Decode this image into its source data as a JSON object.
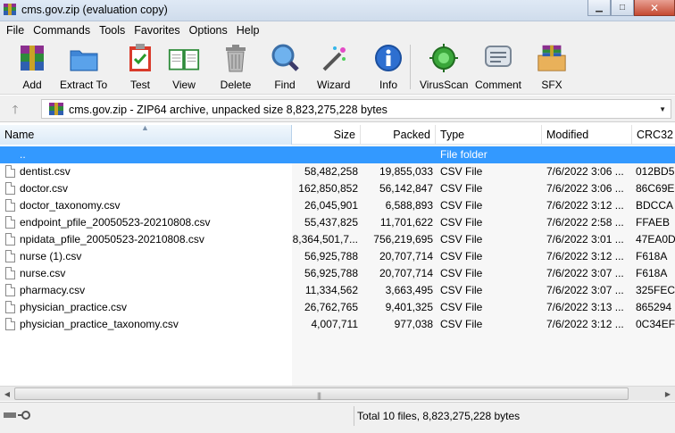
{
  "window": {
    "title": "cms.gov.zip (evaluation copy)"
  },
  "menu": [
    "File",
    "Commands",
    "Tools",
    "Favorites",
    "Options",
    "Help"
  ],
  "toolbar": {
    "add": "Add",
    "extract": "Extract To",
    "test": "Test",
    "view": "View",
    "delete": "Delete",
    "find": "Find",
    "wizard": "Wizard",
    "info": "Info",
    "virusscan": "VirusScan",
    "comment": "Comment",
    "sfx": "SFX"
  },
  "address": {
    "text": "cms.gov.zip - ZIP64 archive, unpacked size 8,823,275,228 bytes"
  },
  "columns": {
    "name": "Name",
    "size": "Size",
    "packed": "Packed",
    "type": "Type",
    "modified": "Modified",
    "crc": "CRC32"
  },
  "parent_row": {
    "name": "..",
    "type": "File folder"
  },
  "files": [
    {
      "name": "dentist.csv",
      "size": "58,482,258",
      "packed": "19,855,033",
      "type": "CSV File",
      "modified": "7/6/2022 3:06 ...",
      "crc": "012BD5"
    },
    {
      "name": "doctor.csv",
      "size": "162,850,852",
      "packed": "56,142,847",
      "type": "CSV File",
      "modified": "7/6/2022 3:06 ...",
      "crc": "86C69E"
    },
    {
      "name": "doctor_taxonomy.csv",
      "size": "26,045,901",
      "packed": "6,588,893",
      "type": "CSV File",
      "modified": "7/6/2022 3:12 ...",
      "crc": "BDCCA"
    },
    {
      "name": "endpoint_pfile_20050523-20210808.csv",
      "size": "55,437,825",
      "packed": "11,701,622",
      "type": "CSV File",
      "modified": "7/6/2022 2:58 ...",
      "crc": "FFAEB"
    },
    {
      "name": "npidata_pfile_20050523-20210808.csv",
      "size": "8,364,501,7...",
      "packed": "756,219,695",
      "type": "CSV File",
      "modified": "7/6/2022 3:01 ...",
      "crc": "47EA0D"
    },
    {
      "name": "nurse (1).csv",
      "size": "56,925,788",
      "packed": "20,707,714",
      "type": "CSV File",
      "modified": "7/6/2022 3:12 ...",
      "crc": "F618A"
    },
    {
      "name": "nurse.csv",
      "size": "56,925,788",
      "packed": "20,707,714",
      "type": "CSV File",
      "modified": "7/6/2022 3:07 ...",
      "crc": "F618A"
    },
    {
      "name": "pharmacy.csv",
      "size": "11,334,562",
      "packed": "3,663,495",
      "type": "CSV File",
      "modified": "7/6/2022 3:07 ...",
      "crc": "325FEC"
    },
    {
      "name": "physician_practice.csv",
      "size": "26,762,765",
      "packed": "9,401,325",
      "type": "CSV File",
      "modified": "7/6/2022 3:13 ...",
      "crc": "865294"
    },
    {
      "name": "physician_practice_taxonomy.csv",
      "size": "4,007,711",
      "packed": "977,038",
      "type": "CSV File",
      "modified": "7/6/2022 3:12 ...",
      "crc": "0C34EF"
    }
  ],
  "status": {
    "summary": "Total 10 files, 8,823,275,228 bytes"
  },
  "colors": {
    "selection": "#3399ff",
    "sorted_header": "#dbeaf7"
  }
}
